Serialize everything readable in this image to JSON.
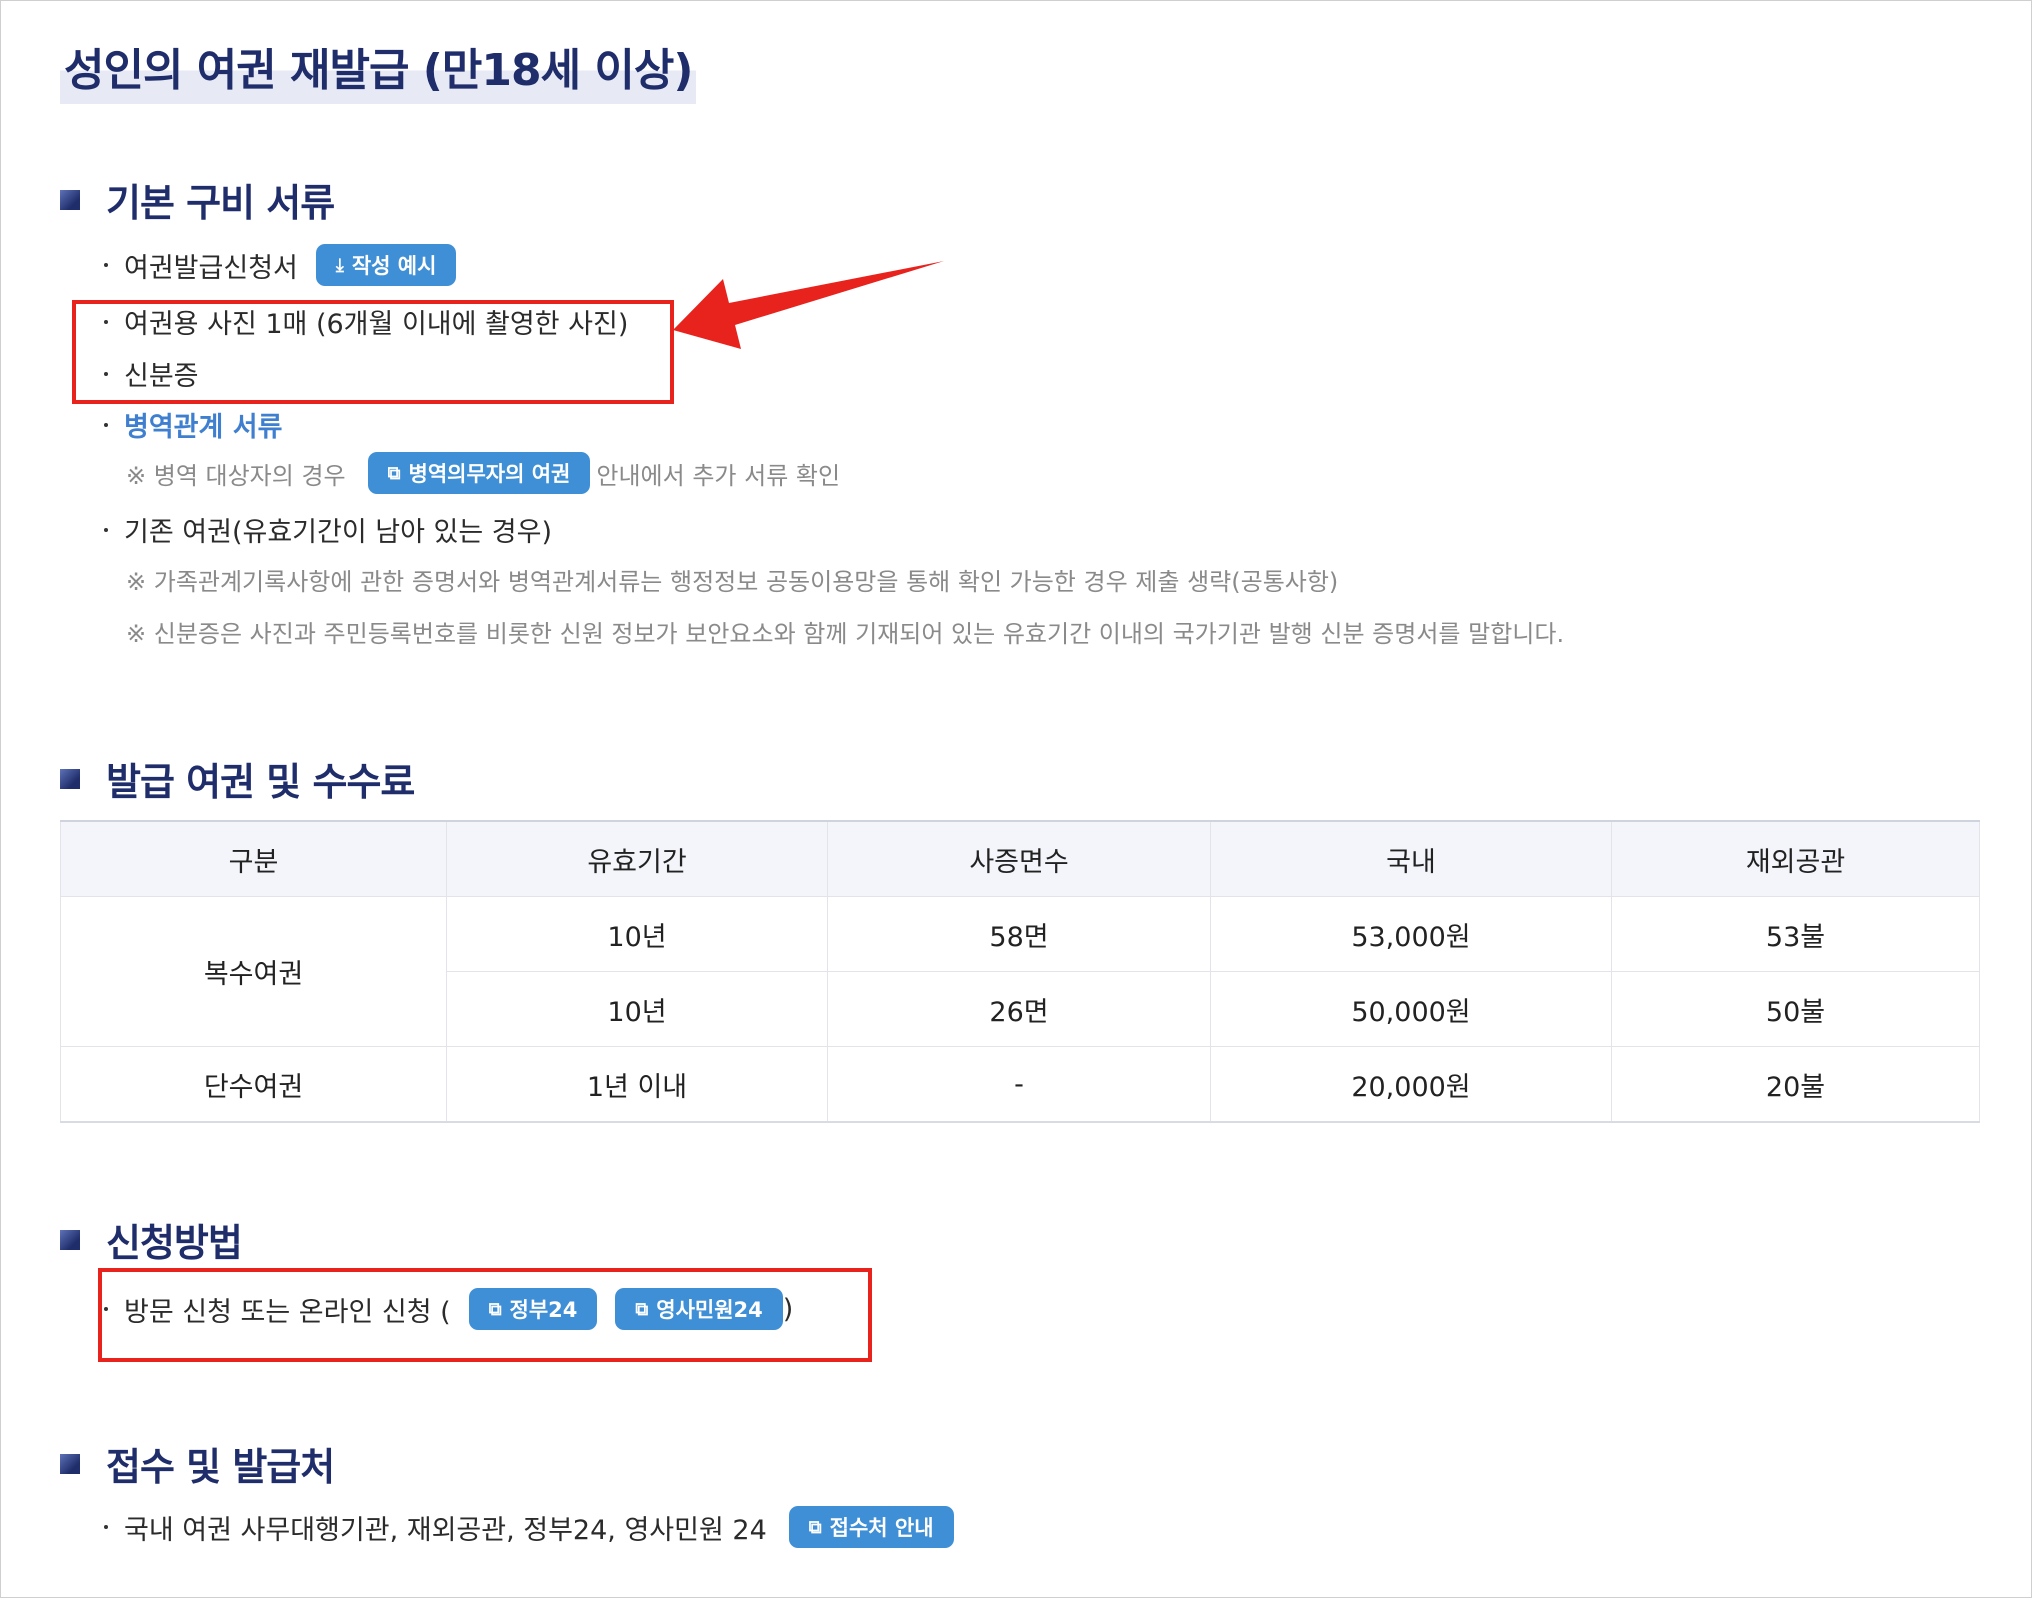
{
  "page_title": "성인의 여권 재발급 (만18세 이상)",
  "section1": {
    "title": "기본 구비 서류",
    "items": [
      "여권발급신청서",
      "여권용 사진 1매 (6개월 이내에 촬영한 사진)",
      "신분증",
      "병역관계 서류",
      "기존 여권(유효기간이 남아 있는 경우)"
    ],
    "example_button": "작성 예시",
    "military_note_prefix": "※ 병역 대상자의 경우",
    "military_button": "병역의무자의 여권",
    "military_note_suffix": "안내에서 추가 서류 확인",
    "note1": "※ 가족관계기록사항에 관한 증명서와 병역관계서류는 행정정보 공동이용망을 통해 확인 가능한 경우 제출 생략(공통사항)",
    "note2": "※ 신분증은 사진과 주민등록번호를 비롯한 신원 정보가 보안요소와 함께 기재되어 있는 유효기간 이내의 국가기관 발행 신분 증명서를 말합니다."
  },
  "section2": {
    "title": "발급 여권 및 수수료",
    "headers": [
      "구분",
      "유효기간",
      "사증면수",
      "국내",
      "재외공관"
    ],
    "rows": [
      {
        "type": "복수여권",
        "period": "10년",
        "pages": "58면",
        "domestic": "53,000원",
        "overseas": "53불"
      },
      {
        "period": "10년",
        "pages": "26면",
        "domestic": "50,000원",
        "overseas": "50불"
      },
      {
        "type": "단수여권",
        "period": "1년 이내",
        "pages": "-",
        "domestic": "20,000원",
        "overseas": "20불"
      }
    ]
  },
  "section3": {
    "title": "신청방법",
    "item_prefix": "방문 신청 또는 온라인 신청 (",
    "button1": "정부24",
    "button2": "영사민원24",
    "item_suffix": ")"
  },
  "section4": {
    "title": "접수 및 발급처",
    "item": "국내 여권 사무대행기관, 재외공관, 정부24, 영사민원 24",
    "button": "접수처 안내"
  },
  "colors": {
    "heading": "#1f2d6b",
    "button": "#3f8fd6",
    "link": "#3f7fcf",
    "highlight": "#e8231d"
  }
}
